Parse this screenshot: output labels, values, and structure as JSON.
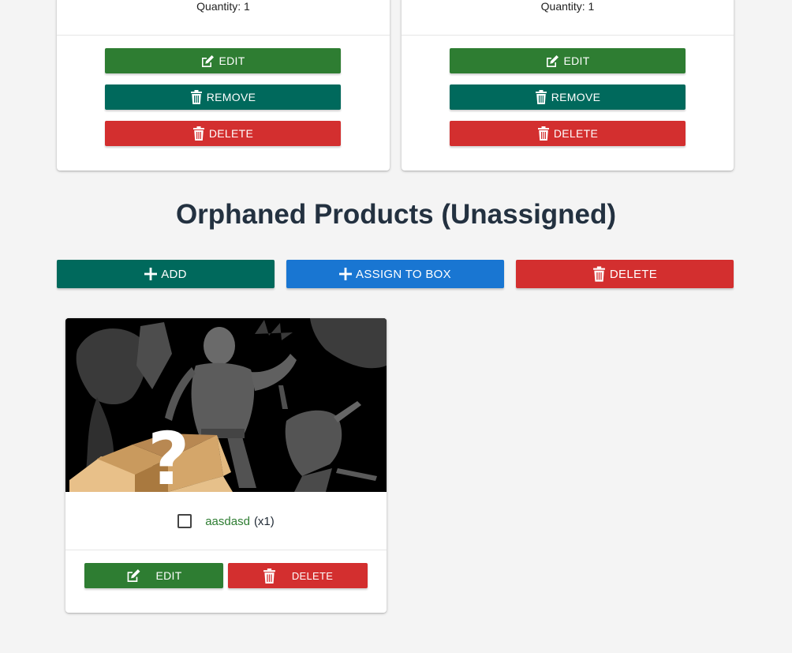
{
  "boxes": [
    {
      "quantity_text": "Quantity: 1",
      "edit_label": "EDIT",
      "remove_label": "REMOVE",
      "delete_label": "DELETE"
    },
    {
      "quantity_text": "Quantity: 1",
      "edit_label": "EDIT",
      "remove_label": "REMOVE",
      "delete_label": "DELETE"
    }
  ],
  "orphaned": {
    "title": "Orphaned Products (Unassigned)",
    "add_label": "ADD",
    "assign_label": "ASSIGN TO BOX",
    "delete_label": "DELETE"
  },
  "products": [
    {
      "name": "aasdasd",
      "count": "(x1)",
      "selected": false,
      "edit_label": "EDIT",
      "delete_label": "DELETE"
    }
  ],
  "icons": {
    "edit": "edit-icon",
    "remove": "trash-icon",
    "delete": "trash-icon",
    "add": "plus-icon"
  },
  "colors": {
    "edit": "#2e7d32",
    "remove": "#00695c",
    "delete": "#d32f2f",
    "assign": "#1976d2",
    "background": "#f4f4f4"
  }
}
